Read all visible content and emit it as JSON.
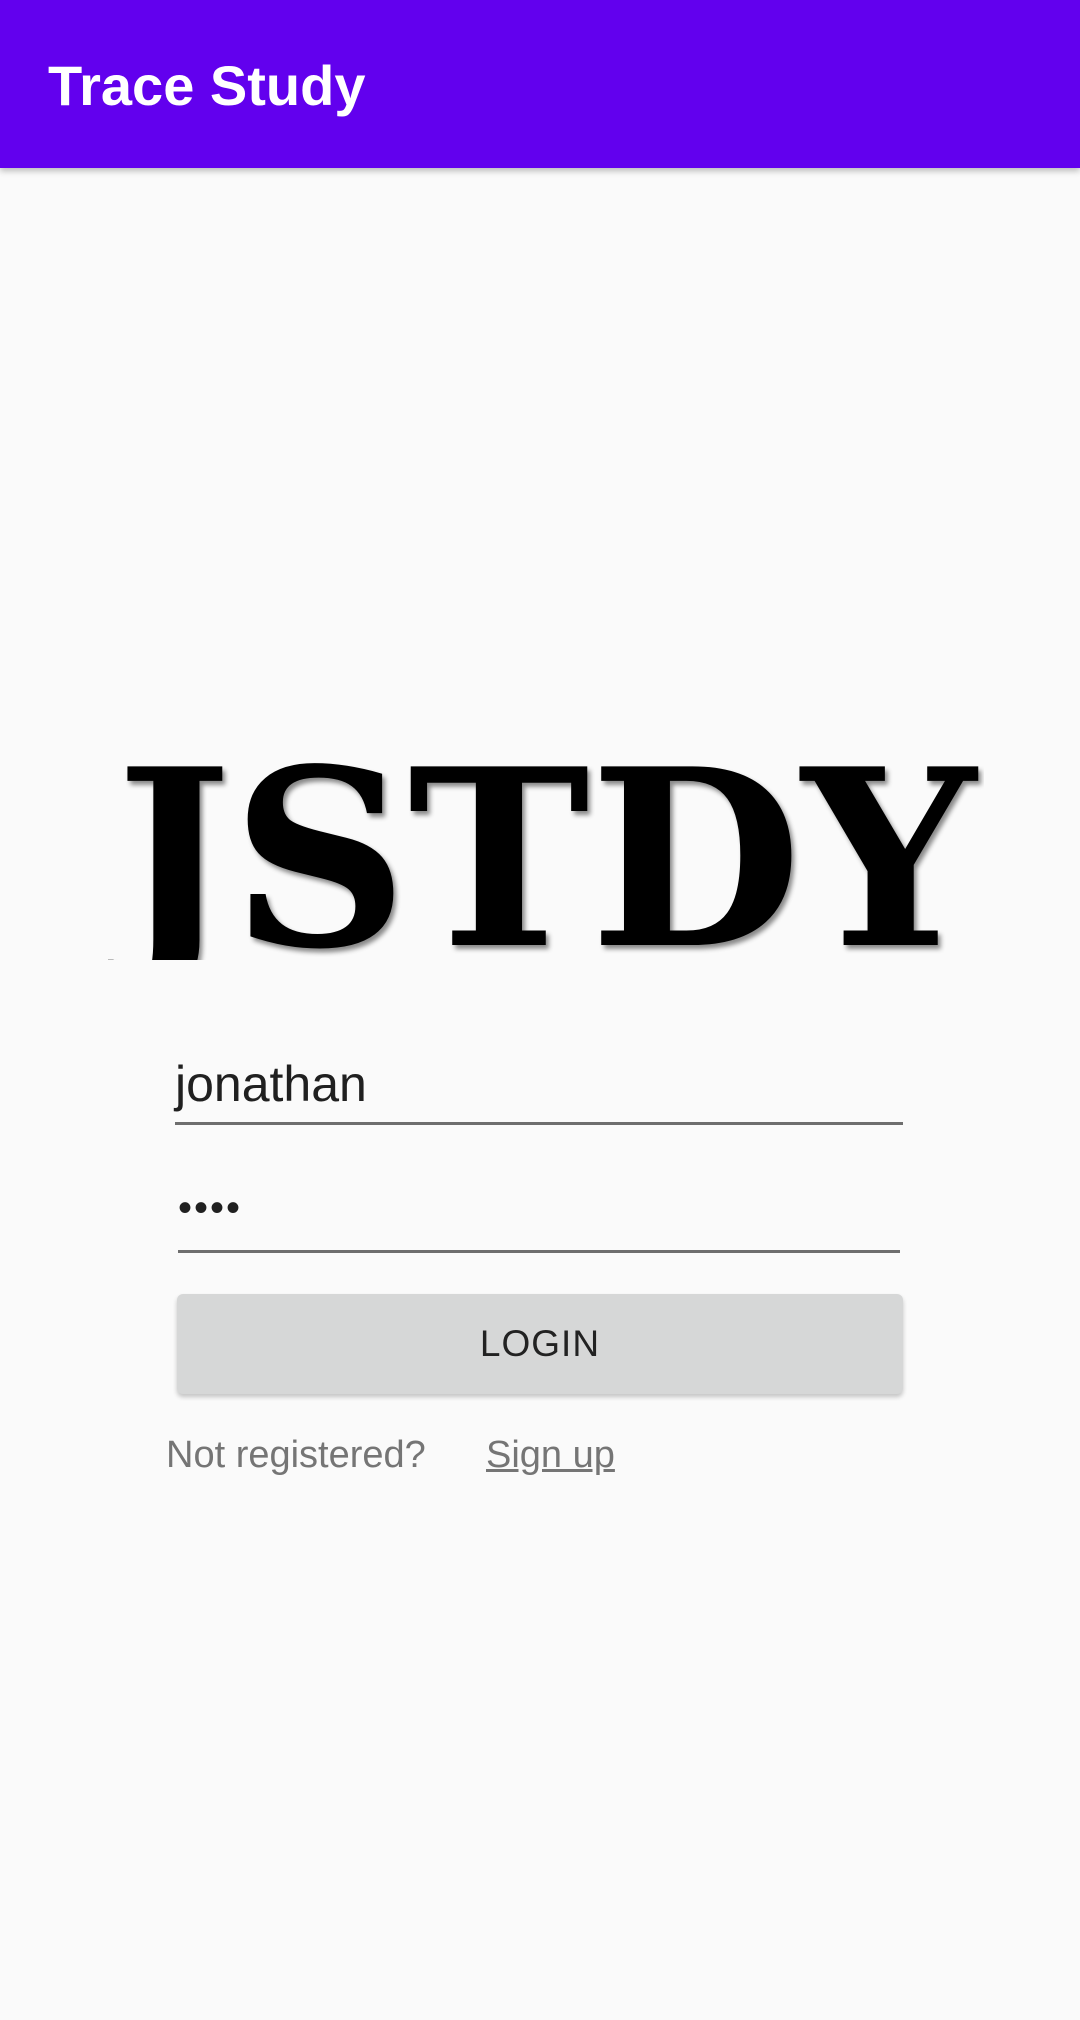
{
  "app_bar": {
    "title": "Trace Study",
    "background_color": "#6200ee"
  },
  "logo": {
    "text": "JSTDY"
  },
  "login_form": {
    "username_value": "jonathan",
    "password_mask": "••••",
    "login_label": "LOGIN",
    "not_registered_text": "Not registered?",
    "signup_link_text": "Sign up"
  }
}
